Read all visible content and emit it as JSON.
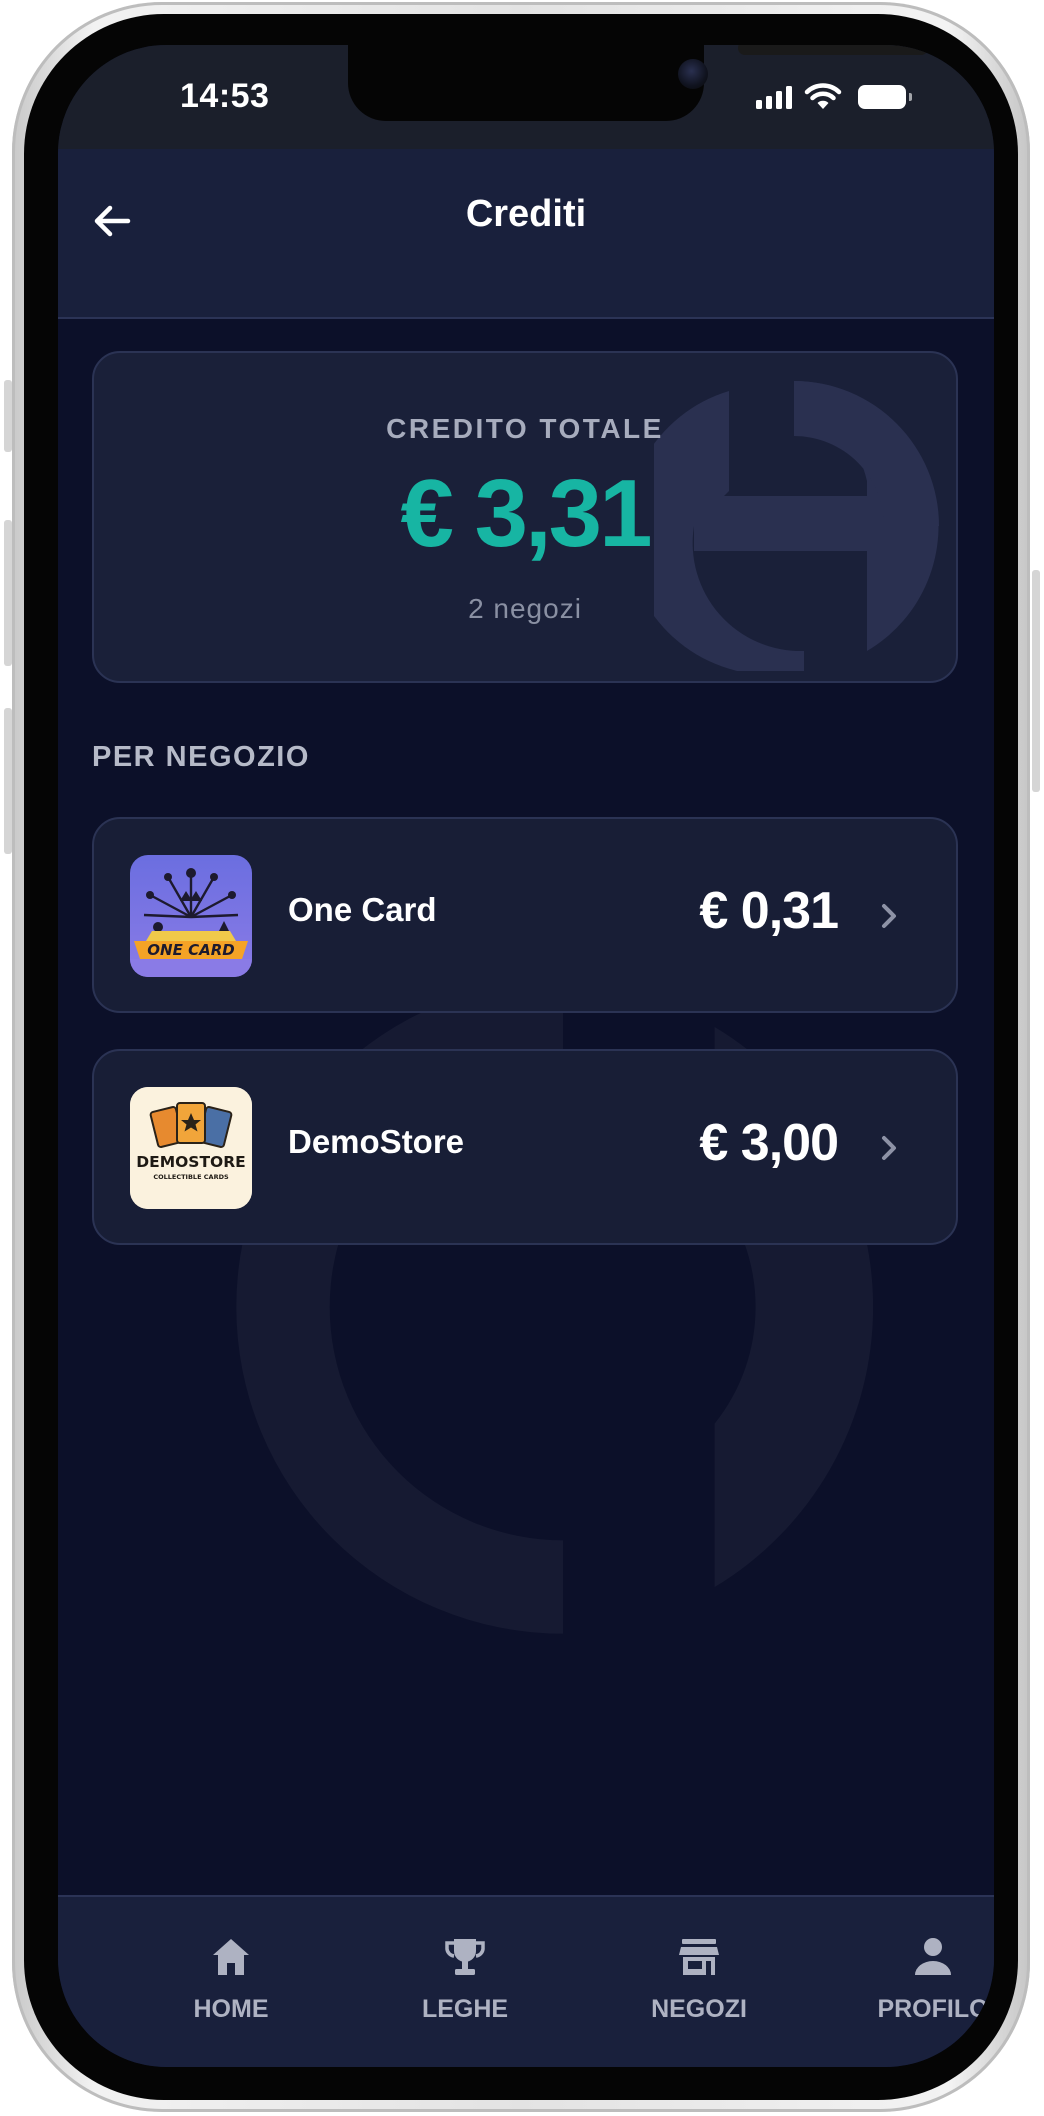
{
  "status_bar": {
    "time": "14:53"
  },
  "header": {
    "title": "Crediti"
  },
  "total_card": {
    "label": "CREDITO TOTALE",
    "amount": "€ 3,31",
    "stores_count": "2 negozi"
  },
  "section": {
    "label": "PER NEGOZIO"
  },
  "stores": [
    {
      "name": "One Card",
      "amount": "€ 0,31",
      "logo_text": "ONE CARD"
    },
    {
      "name": "DemoStore",
      "amount": "€ 3,00",
      "logo_text": "DEMOSTORE",
      "logo_subtext": "COLLECTIBLE CARDS"
    }
  ],
  "tab_bar": {
    "items": [
      {
        "label": "HOME",
        "icon": "home-icon"
      },
      {
        "label": "LEGHE",
        "icon": "trophy-icon"
      },
      {
        "label": "NEGOZI",
        "icon": "store-icon"
      },
      {
        "label": "PROFILO",
        "icon": "profile-icon"
      }
    ]
  },
  "colors": {
    "accent": "#17b5a3",
    "background": "#0c1029",
    "card": "#1a2039",
    "header": "#19203c"
  }
}
